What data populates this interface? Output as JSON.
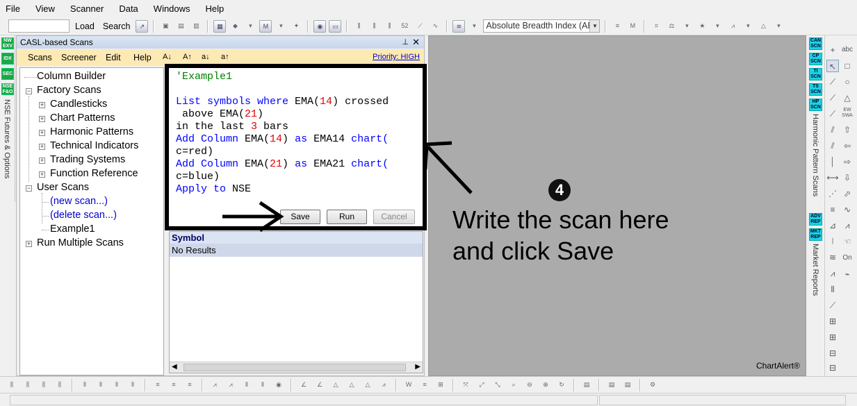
{
  "menubar": {
    "items": [
      "File",
      "View",
      "Scanner",
      "Data",
      "Windows",
      "Help"
    ]
  },
  "toolbar": {
    "load_label": "Load",
    "search_label": "Search",
    "indicator_select": "Absolute Breadth Index (ABI"
  },
  "left_strip": {
    "buttons": [
      "NW EXV",
      "IDX",
      "SEC",
      "NSE F&O"
    ],
    "vertical_label": "NSE Futures & Options"
  },
  "panel": {
    "title": "CASL-based Scans",
    "menu": [
      "Scans",
      "Screener",
      "Edit",
      "Help"
    ],
    "font_buttons": [
      "A↓",
      "A↑",
      "a↓",
      "a↑"
    ],
    "priority": "Priority: HIGH"
  },
  "tree": {
    "column_builder": "Column Builder",
    "factory_scans": "Factory Scans",
    "factory_children": [
      "Candlesticks",
      "Chart Patterns",
      "Harmonic Patterns",
      "Technical Indicators",
      "Trading Systems",
      "Function Reference"
    ],
    "user_scans": "User Scans",
    "new_scan": "(new scan...)",
    "delete_scan": "(delete scan...)",
    "example": "Example1",
    "run_multiple": "Run Multiple Scans"
  },
  "editor": {
    "line1": "'Example1",
    "l2a": "List symbols where",
    "l2b": " EMA(",
    "l2c": "14",
    "l2d": ") crossed",
    "l3a": " above EMA(",
    "l3b": "21",
    "l3c": ")",
    "l4a": "in the last ",
    "l4b": "3",
    "l4c": " bars",
    "l5a": "Add Column",
    "l5b": " EMA(",
    "l5c": "14",
    "l5d": ") ",
    "l5e": "as",
    "l5f": " EMA14 ",
    "l5g": "chart(",
    "l6": "c=red)",
    "l7a": "Add Column",
    "l7b": " EMA(",
    "l7c": "21",
    "l7d": ") ",
    "l7e": "as",
    "l7f": " EMA21 ",
    "l7g": "chart(",
    "l8": "c=blue)",
    "l9a": "Apply to",
    "l9b": " NSE",
    "save_label": "Save",
    "run_label": "Run",
    "cancel_label": "Cancel"
  },
  "results": {
    "header": "Symbol",
    "row": "No Results"
  },
  "annotation": {
    "step": "4",
    "text": "Write the scan here\nand click Save"
  },
  "brand": "ChartAlert®",
  "right_strip": {
    "buttons": [
      "CAN SCN",
      "CP SCN",
      "TI SCN",
      "TS SCN",
      "HP SCN",
      "ADV REP",
      "MKT REP"
    ],
    "label_top": "Harmonic Pattern Scans",
    "label_bottom": "Market Reports"
  },
  "draw_tools": {
    "abc_label": "abc",
    "on_label": "On",
    "ew_label": "EW SWA"
  }
}
